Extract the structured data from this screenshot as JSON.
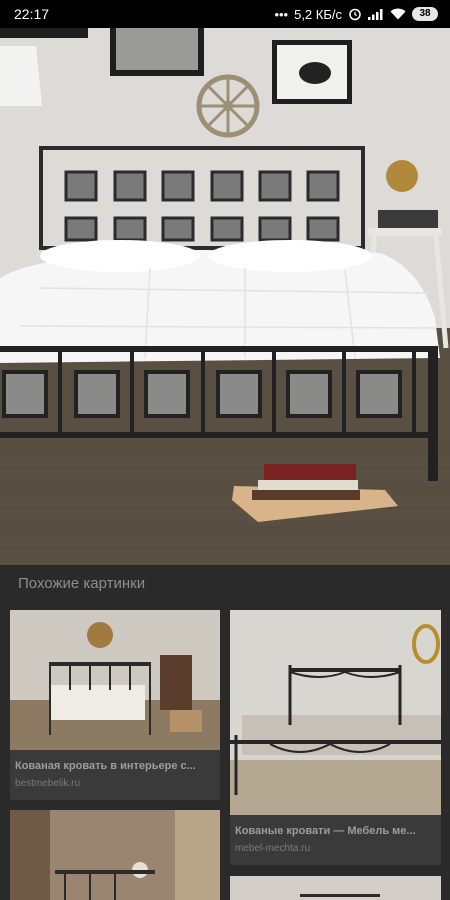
{
  "status_bar": {
    "time": "22:17",
    "dots": "•••",
    "network_speed": "5,2 КБ/с",
    "battery": "38",
    "icons": [
      "alarm-icon",
      "signal-icon",
      "wifi-icon",
      "battery-icon"
    ]
  },
  "main_image": {
    "subject": "metal-square-pattern-bed-photo"
  },
  "related": {
    "section_title": "Похожие картинки",
    "cards": [
      {
        "title": "Кованая кровать в интерьере с...",
        "source": "bestmebelik.ru"
      },
      {
        "title": "Кованые кровати — Мебель ме...",
        "source": "mebel-mechta.ru"
      },
      {
        "title": "",
        "source": ""
      },
      {
        "title": "",
        "source": ""
      }
    ]
  },
  "colors": {
    "background": "#202124",
    "panel": "#2a2a2b",
    "muted_text": "#8d8d8d"
  }
}
